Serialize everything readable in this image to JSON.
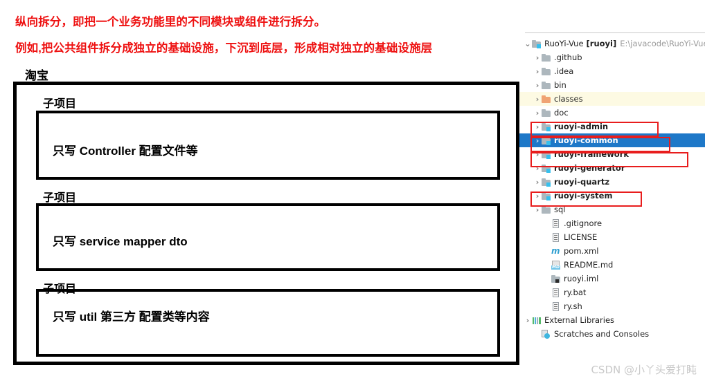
{
  "notes": {
    "line1": "纵向拆分，即把一个业务功能里的不同模块或组件进行拆分。",
    "line2": "例如,把公共组件拆分成独立的基础设施，下沉到底层，形成相对独立的基础设施层",
    "color": "#ee1111"
  },
  "diagram": {
    "root_label": "淘宝",
    "subprojects": [
      {
        "label": "子项目",
        "content": "只写 Controller  配置文件等"
      },
      {
        "label": "子项目",
        "content": "只写 service  mapper  dto"
      },
      {
        "label": "子项目",
        "content": "只写 util  第三方 配置类等内容"
      }
    ]
  },
  "tree": {
    "root": {
      "name": "RuoYi-Vue",
      "module": "[ruoyi]",
      "path": "E:\\javacode\\RuoYi-Vue",
      "twisty": "⌄"
    },
    "rows": [
      {
        "label": ".github",
        "indent": 1,
        "twisty": "›",
        "icon": "folder",
        "bold": false,
        "state": "normal"
      },
      {
        "label": ".idea",
        "indent": 1,
        "twisty": "›",
        "icon": "folder",
        "bold": false,
        "state": "normal"
      },
      {
        "label": "bin",
        "indent": 1,
        "twisty": "›",
        "icon": "folder",
        "bold": false,
        "state": "normal"
      },
      {
        "label": "classes",
        "indent": 1,
        "twisty": "›",
        "icon": "folder-orange",
        "bold": false,
        "state": "yellow"
      },
      {
        "label": "doc",
        "indent": 1,
        "twisty": "›",
        "icon": "folder",
        "bold": false,
        "state": "normal"
      },
      {
        "label": "ruoyi-admin",
        "indent": 1,
        "twisty": "›",
        "icon": "module",
        "bold": true,
        "state": "normal"
      },
      {
        "label": "ruoyi-common",
        "indent": 1,
        "twisty": "›",
        "icon": "module",
        "bold": true,
        "state": "selected"
      },
      {
        "label": "ruoyi-framework",
        "indent": 1,
        "twisty": "›",
        "icon": "module",
        "bold": true,
        "state": "normal"
      },
      {
        "label": "ruoyi-generator",
        "indent": 1,
        "twisty": "›",
        "icon": "module",
        "bold": true,
        "state": "normal"
      },
      {
        "label": "ruoyi-quartz",
        "indent": 1,
        "twisty": "›",
        "icon": "module",
        "bold": true,
        "state": "normal"
      },
      {
        "label": "ruoyi-system",
        "indent": 1,
        "twisty": "›",
        "icon": "module",
        "bold": true,
        "state": "normal"
      },
      {
        "label": "sql",
        "indent": 1,
        "twisty": "›",
        "icon": "folder",
        "bold": false,
        "state": "normal"
      },
      {
        "label": ".gitignore",
        "indent": 2,
        "twisty": "",
        "icon": "file",
        "bold": false,
        "state": "normal"
      },
      {
        "label": "LICENSE",
        "indent": 2,
        "twisty": "",
        "icon": "file",
        "bold": false,
        "state": "normal"
      },
      {
        "label": "pom.xml",
        "indent": 2,
        "twisty": "",
        "icon": "maven",
        "bold": false,
        "state": "normal"
      },
      {
        "label": "README.md",
        "indent": 2,
        "twisty": "",
        "icon": "md",
        "bold": false,
        "state": "normal"
      },
      {
        "label": "ruoyi.iml",
        "indent": 2,
        "twisty": "",
        "icon": "iml",
        "bold": false,
        "state": "normal"
      },
      {
        "label": "ry.bat",
        "indent": 2,
        "twisty": "",
        "icon": "file",
        "bold": false,
        "state": "normal"
      },
      {
        "label": "ry.sh",
        "indent": 2,
        "twisty": "",
        "icon": "file",
        "bold": false,
        "state": "normal"
      },
      {
        "label": "External Libraries",
        "indent": 0,
        "twisty": "›",
        "icon": "libs",
        "bold": false,
        "state": "normal"
      },
      {
        "label": "Scratches and Consoles",
        "indent": 1,
        "twisty": "",
        "icon": "scratch",
        "bold": false,
        "state": "normal"
      }
    ],
    "md_tag": "MD",
    "maven_glyph": "m",
    "selection_color": "#1e78c8",
    "highlight_color": "#fdfae3",
    "annotation_color": "#e81d1d",
    "annotated_rows": [
      "ruoyi-admin",
      "ruoyi-common",
      "ruoyi-framework",
      "ruoyi-system"
    ]
  },
  "watermark": {
    "text": "CSDN @小丫头爱打盹"
  }
}
